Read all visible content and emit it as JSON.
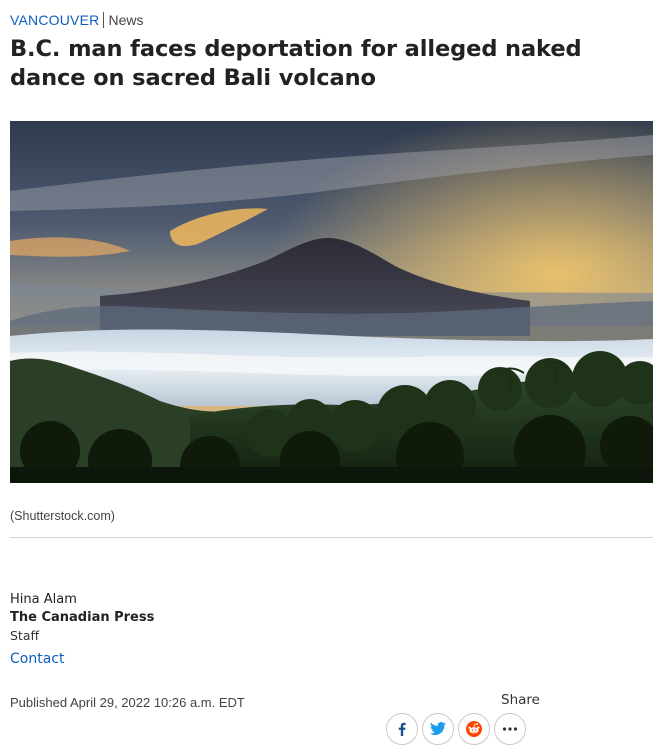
{
  "article": {
    "section": "VANCOUVER",
    "subsection": "News",
    "headline": "B.C. man faces deportation for alleged naked dance on sacred Bali volcano",
    "image_caption": "(Shutterstock.com)",
    "author": {
      "name": "Hina Alam",
      "organization": "The Canadian Press",
      "role": "Staff",
      "contact_label": "Contact"
    },
    "published": "Published April 29, 2022 10:26 a.m. EDT"
  },
  "share": {
    "label": "Share",
    "buttons": [
      {
        "icon": "facebook-icon",
        "color": "#1b4f8a"
      },
      {
        "icon": "twitter-icon",
        "color": "#1d9bf0"
      },
      {
        "icon": "reddit-icon",
        "color": "#ff4500"
      },
      {
        "icon": "more-icon",
        "color": "#333333"
      }
    ]
  },
  "colors": {
    "link": "#0e5fbf",
    "text": "#222222",
    "rule": "#d4d4d4"
  }
}
